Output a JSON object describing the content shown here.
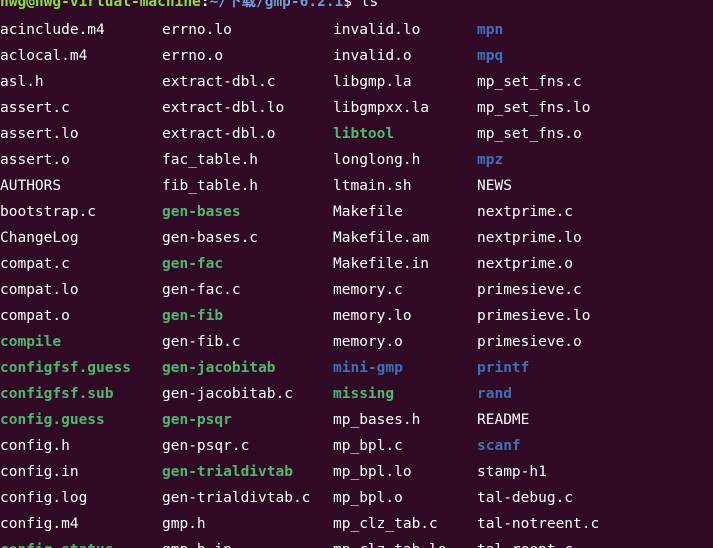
{
  "prompt": {
    "user_host": "hwg@hwg-virtual-machine",
    "separator": ":",
    "path": "~/下载/gmp-6.2.1",
    "dollar": "$",
    "command": " ls"
  },
  "colors": {
    "background": "#300a24",
    "file": "#ffffff",
    "executable": "#4db870",
    "directory": "#3f71b8"
  },
  "rows": [
    [
      {
        "name": "acinclude.m4",
        "kind": "file"
      },
      {
        "name": "errno.lo",
        "kind": "file"
      },
      {
        "name": "invalid.lo",
        "kind": "file"
      },
      {
        "name": "mpn",
        "kind": "dir"
      }
    ],
    [
      {
        "name": "aclocal.m4",
        "kind": "file"
      },
      {
        "name": "errno.o",
        "kind": "file"
      },
      {
        "name": "invalid.o",
        "kind": "file"
      },
      {
        "name": "mpq",
        "kind": "dir"
      }
    ],
    [
      {
        "name": "asl.h",
        "kind": "file"
      },
      {
        "name": "extract-dbl.c",
        "kind": "file"
      },
      {
        "name": "libgmp.la",
        "kind": "file"
      },
      {
        "name": "mp_set_fns.c",
        "kind": "file"
      }
    ],
    [
      {
        "name": "assert.c",
        "kind": "file"
      },
      {
        "name": "extract-dbl.lo",
        "kind": "file"
      },
      {
        "name": "libgmpxx.la",
        "kind": "file"
      },
      {
        "name": "mp_set_fns.lo",
        "kind": "file"
      }
    ],
    [
      {
        "name": "assert.lo",
        "kind": "file"
      },
      {
        "name": "extract-dbl.o",
        "kind": "file"
      },
      {
        "name": "libtool",
        "kind": "exec"
      },
      {
        "name": "mp_set_fns.o",
        "kind": "file"
      }
    ],
    [
      {
        "name": "assert.o",
        "kind": "file"
      },
      {
        "name": "fac_table.h",
        "kind": "file"
      },
      {
        "name": "longlong.h",
        "kind": "file"
      },
      {
        "name": "mpz",
        "kind": "dir"
      }
    ],
    [
      {
        "name": "AUTHORS",
        "kind": "file"
      },
      {
        "name": "fib_table.h",
        "kind": "file"
      },
      {
        "name": "ltmain.sh",
        "kind": "file"
      },
      {
        "name": "NEWS",
        "kind": "file"
      }
    ],
    [
      {
        "name": "bootstrap.c",
        "kind": "file"
      },
      {
        "name": "gen-bases",
        "kind": "exec"
      },
      {
        "name": "Makefile",
        "kind": "file"
      },
      {
        "name": "nextprime.c",
        "kind": "file"
      }
    ],
    [
      {
        "name": "ChangeLog",
        "kind": "file"
      },
      {
        "name": "gen-bases.c",
        "kind": "file"
      },
      {
        "name": "Makefile.am",
        "kind": "file"
      },
      {
        "name": "nextprime.lo",
        "kind": "file"
      }
    ],
    [
      {
        "name": "compat.c",
        "kind": "file"
      },
      {
        "name": "gen-fac",
        "kind": "exec"
      },
      {
        "name": "Makefile.in",
        "kind": "file"
      },
      {
        "name": "nextprime.o",
        "kind": "file"
      }
    ],
    [
      {
        "name": "compat.lo",
        "kind": "file"
      },
      {
        "name": "gen-fac.c",
        "kind": "file"
      },
      {
        "name": "memory.c",
        "kind": "file"
      },
      {
        "name": "primesieve.c",
        "kind": "file"
      }
    ],
    [
      {
        "name": "compat.o",
        "kind": "file"
      },
      {
        "name": "gen-fib",
        "kind": "exec"
      },
      {
        "name": "memory.lo",
        "kind": "file"
      },
      {
        "name": "primesieve.lo",
        "kind": "file"
      }
    ],
    [
      {
        "name": "compile",
        "kind": "exec"
      },
      {
        "name": "gen-fib.c",
        "kind": "file"
      },
      {
        "name": "memory.o",
        "kind": "file"
      },
      {
        "name": "primesieve.o",
        "kind": "file"
      }
    ],
    [
      {
        "name": "configfsf.guess",
        "kind": "exec"
      },
      {
        "name": "gen-jacobitab",
        "kind": "exec"
      },
      {
        "name": "mini-gmp",
        "kind": "dir"
      },
      {
        "name": "printf",
        "kind": "dir"
      }
    ],
    [
      {
        "name": "configfsf.sub",
        "kind": "exec"
      },
      {
        "name": "gen-jacobitab.c",
        "kind": "file"
      },
      {
        "name": "missing",
        "kind": "exec"
      },
      {
        "name": "rand",
        "kind": "dir"
      }
    ],
    [
      {
        "name": "config.guess",
        "kind": "exec"
      },
      {
        "name": "gen-psqr",
        "kind": "exec"
      },
      {
        "name": "mp_bases.h",
        "kind": "file"
      },
      {
        "name": "README",
        "kind": "file"
      }
    ],
    [
      {
        "name": "config.h",
        "kind": "file"
      },
      {
        "name": "gen-psqr.c",
        "kind": "file"
      },
      {
        "name": "mp_bpl.c",
        "kind": "file"
      },
      {
        "name": "scanf",
        "kind": "dir"
      }
    ],
    [
      {
        "name": "config.in",
        "kind": "file"
      },
      {
        "name": "gen-trialdivtab",
        "kind": "exec"
      },
      {
        "name": "mp_bpl.lo",
        "kind": "file"
      },
      {
        "name": "stamp-h1",
        "kind": "file"
      }
    ],
    [
      {
        "name": "config.log",
        "kind": "file"
      },
      {
        "name": "gen-trialdivtab.c",
        "kind": "file"
      },
      {
        "name": "mp_bpl.o",
        "kind": "file"
      },
      {
        "name": "tal-debug.c",
        "kind": "file"
      }
    ],
    [
      {
        "name": "config.m4",
        "kind": "file"
      },
      {
        "name": "gmp.h",
        "kind": "file"
      },
      {
        "name": "mp_clz_tab.c",
        "kind": "file"
      },
      {
        "name": "tal-notreent.c",
        "kind": "file"
      }
    ],
    [
      {
        "name": "config.status",
        "kind": "exec"
      },
      {
        "name": "gmp-h.in",
        "kind": "file"
      },
      {
        "name": "mp_clz_tab.lo",
        "kind": "file"
      },
      {
        "name": "tal-reent.c",
        "kind": "file"
      }
    ]
  ]
}
